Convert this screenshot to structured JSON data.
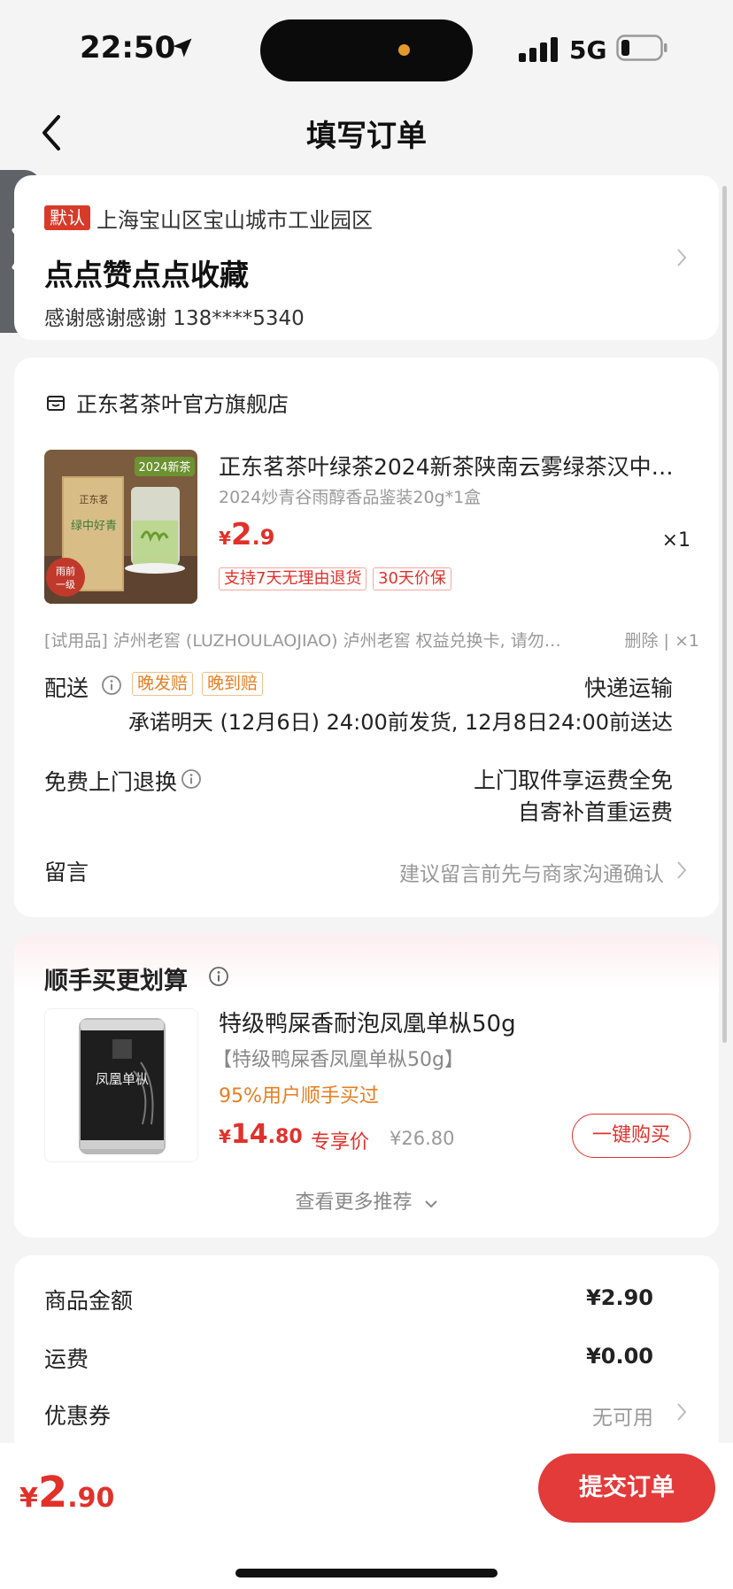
{
  "status_bar": {
    "time": "22:50",
    "network": "5G"
  },
  "nav": {
    "title": "填写订单"
  },
  "address": {
    "default_label": "默认",
    "location": "上海宝山区宝山城市工业园区",
    "name": "点点赞点点收藏",
    "contact": "感谢感谢感谢  138****5340"
  },
  "store": {
    "name": "正东茗茶叶官方旗舰店",
    "product": {
      "title": "正东茗茶叶绿茶2024新茶陕南云雾绿茶汉中…",
      "spec": "2024炒青谷雨醇香品鉴装20g*1盒",
      "price_symbol": "¥",
      "price_int": "2",
      "price_dec": ".9",
      "quantity": "×1",
      "tags": [
        "支持7天无理由退货",
        "30天价保"
      ]
    },
    "trial_item": {
      "text": "[试用品] 泸州老窖 (LUZHOULAOJIAO) 泸州老窖  权益兑换卡, 请勿…",
      "actions": "删除 | ×1"
    },
    "delivery": {
      "label": "配送",
      "tags": [
        "晚发赔",
        "晚到赔"
      ],
      "method": "快递运输",
      "promise": "承诺明天 (12月6日) 24:00前发货, 12月8日24:00前送达"
    },
    "return": {
      "label": "免费上门退换",
      "line1": "上门取件享运费全免",
      "line2": "自寄补首重运费"
    },
    "remark": {
      "label": "留言",
      "hint": "建议留言前先与商家沟通确认"
    }
  },
  "recommend": {
    "title": "顺手买更划算",
    "product": {
      "name": "特级鸭屎香耐泡凤凰单枞50g",
      "spec": "【特级鸭屎香凤凰单枞50g】",
      "social": "95%用户顺手买过",
      "price_symbol": "¥",
      "price_int": "14",
      "price_dec": ".80",
      "exclusive": "专享价",
      "original": "¥26.80",
      "buy_label": "一键购买",
      "can_text": "凤凰单枞"
    },
    "more_label": "查看更多推荐"
  },
  "summary": {
    "goods_label": "商品金额",
    "goods_value": "¥2.90",
    "shipping_label": "运费",
    "shipping_value": "¥0.00",
    "coupon_label": "优惠券",
    "coupon_value": "无可用"
  },
  "footer": {
    "price_symbol": "¥",
    "price_int": "2",
    "price_dec": ".90",
    "submit_label": "提交订单"
  },
  "product_image": {
    "badge": "2024新茶",
    "seal": "雨前一级",
    "box_text": "绿中好青"
  },
  "colors": {
    "accent": "#e0312b",
    "orange": "#e67e22",
    "default_badge": "#d83a2a"
  },
  "icons": [
    "location-arrow-icon",
    "signal-icon",
    "battery-icon",
    "back-chevron-icon",
    "side-expand-icon",
    "store-icon",
    "info-icon",
    "chevron-right-icon",
    "chevron-down-icon"
  ]
}
